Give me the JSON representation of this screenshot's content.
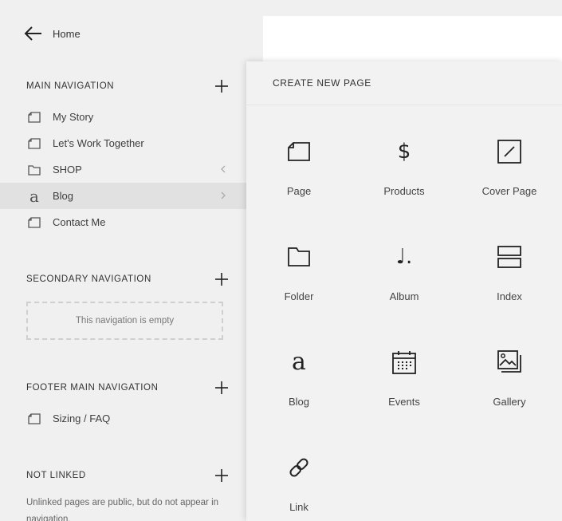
{
  "sidebar": {
    "home_label": "Home",
    "sections": {
      "main": {
        "title": "MAIN NAVIGATION",
        "items": [
          {
            "label": "My Story",
            "icon": "page-icon"
          },
          {
            "label": "Let's Work Together",
            "icon": "page-icon"
          },
          {
            "label": "SHOP",
            "icon": "folder-icon"
          },
          {
            "label": "Blog",
            "icon": "blog-icon",
            "active": true
          },
          {
            "label": "Contact Me",
            "icon": "page-icon"
          }
        ]
      },
      "secondary": {
        "title": "SECONDARY NAVIGATION",
        "empty_text": "This navigation is empty"
      },
      "footer": {
        "title": "FOOTER MAIN NAVIGATION",
        "items": [
          {
            "label": "Sizing / FAQ",
            "icon": "page-icon"
          }
        ]
      },
      "not_linked": {
        "title": "NOT LINKED",
        "note": "Unlinked pages are public, but do not appear in navigation."
      }
    }
  },
  "panel": {
    "title": "CREATE NEW PAGE",
    "types": [
      {
        "label": "Page",
        "icon": "page-icon"
      },
      {
        "label": "Products",
        "icon": "dollar-icon",
        "glyph": "$"
      },
      {
        "label": "Cover Page",
        "icon": "cover-page-icon"
      },
      {
        "label": "Folder",
        "icon": "folder-icon"
      },
      {
        "label": "Album",
        "icon": "music-note-icon",
        "glyph": "♩."
      },
      {
        "label": "Index",
        "icon": "index-icon"
      },
      {
        "label": "Blog",
        "icon": "blog-icon",
        "glyph": "a"
      },
      {
        "label": "Events",
        "icon": "calendar-icon"
      },
      {
        "label": "Gallery",
        "icon": "gallery-icon"
      },
      {
        "label": "Link",
        "icon": "link-icon"
      }
    ]
  },
  "colors": {
    "background": "#f0f0f0",
    "active_row": "#e1e1e1",
    "text": "#3a3a3a",
    "panel": "#f2f2f2"
  }
}
